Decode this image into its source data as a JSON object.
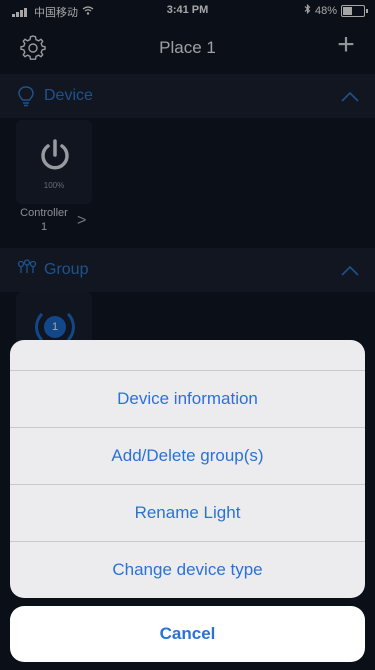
{
  "status_bar": {
    "carrier": "中国移动",
    "time": "3:41 PM",
    "battery": "48%",
    "battery_level": 0.48
  },
  "nav": {
    "title": "Place 1",
    "add_symbol": "+",
    "settings_icon": "gear-icon"
  },
  "sections": {
    "device": {
      "label": "Device",
      "icon": "bulb-icon"
    },
    "group": {
      "label": "Group",
      "icon": "group-icon"
    }
  },
  "device_tile": {
    "icon": "power-icon",
    "brightness": "100%",
    "name": "Controller 1",
    "arrow": ">"
  },
  "group_tile": {
    "badge": "1"
  },
  "action_sheet": {
    "items": [
      "Device information",
      "Add/Delete group(s)",
      "Rename Light",
      "Change device type"
    ],
    "cancel": "Cancel"
  },
  "colors": {
    "accent": "#2f7fd7",
    "sheet_text": "#2a72d8",
    "background": "#121826"
  }
}
